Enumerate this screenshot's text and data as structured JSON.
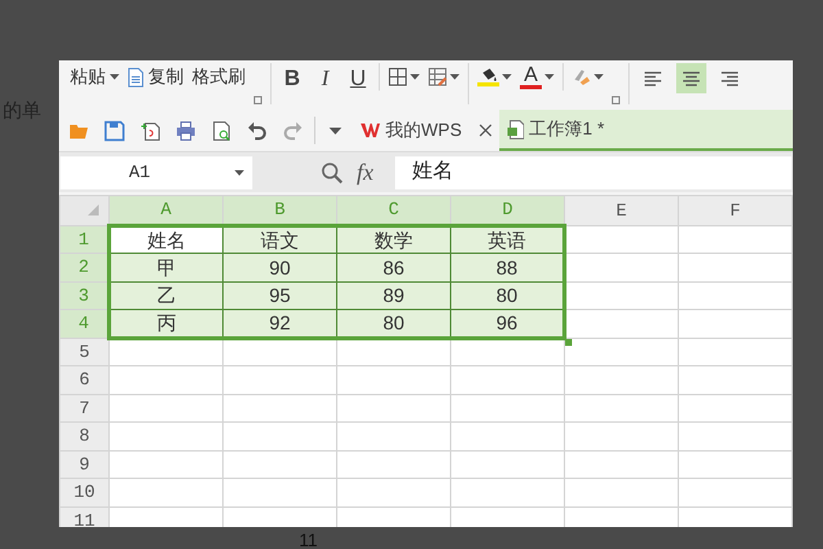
{
  "background_texts": [
    "的单",
    "11"
  ],
  "ribbon": {
    "paste": {
      "label": "粘贴"
    },
    "copy": {
      "label": "复制"
    },
    "format_painter": {
      "label": "格式刷"
    },
    "font_styles": [
      {
        "label": "B",
        "kind": "bold"
      },
      {
        "label": "I",
        "kind": "italic"
      },
      {
        "label": "U",
        "kind": "underline"
      }
    ],
    "font_color": {
      "label": "A",
      "color": "#e02020"
    },
    "fill_color": {
      "color": "#f5e400"
    },
    "alignment": [
      {
        "kind": "left",
        "selected": false
      },
      {
        "kind": "center",
        "selected": true
      },
      {
        "kind": "right",
        "selected": false
      }
    ]
  },
  "tabs": [
    {
      "label": "我的WPS",
      "kind": "home",
      "selected": false,
      "closable": true
    },
    {
      "label": "工作簿1 *",
      "kind": "workbook",
      "selected": true,
      "closable": false
    }
  ],
  "formula_bar": {
    "name_box": "A1",
    "fx": "fx",
    "value": "姓名"
  },
  "grid": {
    "columns": [
      {
        "label": "A",
        "selected": true
      },
      {
        "label": "B",
        "selected": true
      },
      {
        "label": "C",
        "selected": true
      },
      {
        "label": "D",
        "selected": true
      },
      {
        "label": "E",
        "selected": false
      },
      {
        "label": "F",
        "selected": false
      }
    ],
    "rows": [
      {
        "label": "1",
        "selected": true,
        "cells": [
          {
            "text": "姓名",
            "active": true
          },
          {
            "text": "语文",
            "active": false
          },
          {
            "text": "数学",
            "active": false
          },
          {
            "text": "英语",
            "active": false
          }
        ]
      },
      {
        "label": "2",
        "selected": true,
        "cells": [
          {
            "text": "甲",
            "active": false
          },
          {
            "text": "90",
            "active": false
          },
          {
            "text": "86",
            "active": false
          },
          {
            "text": "88",
            "active": false
          }
        ]
      },
      {
        "label": "3",
        "selected": true,
        "cells": [
          {
            "text": "乙",
            "active": false
          },
          {
            "text": "95",
            "active": false
          },
          {
            "text": "89",
            "active": false
          },
          {
            "text": "80",
            "active": false
          }
        ]
      },
      {
        "label": "4",
        "selected": true,
        "cells": [
          {
            "text": "丙",
            "active": false
          },
          {
            "text": "92",
            "active": false
          },
          {
            "text": "80",
            "active": false
          },
          {
            "text": "96",
            "active": false
          }
        ]
      },
      {
        "label": "5",
        "selected": false
      },
      {
        "label": "6",
        "selected": false
      },
      {
        "label": "7",
        "selected": false
      },
      {
        "label": "8",
        "selected": false
      },
      {
        "label": "9",
        "selected": false
      },
      {
        "label": "10",
        "selected": false
      },
      {
        "label": "11",
        "selected": false
      }
    ]
  }
}
